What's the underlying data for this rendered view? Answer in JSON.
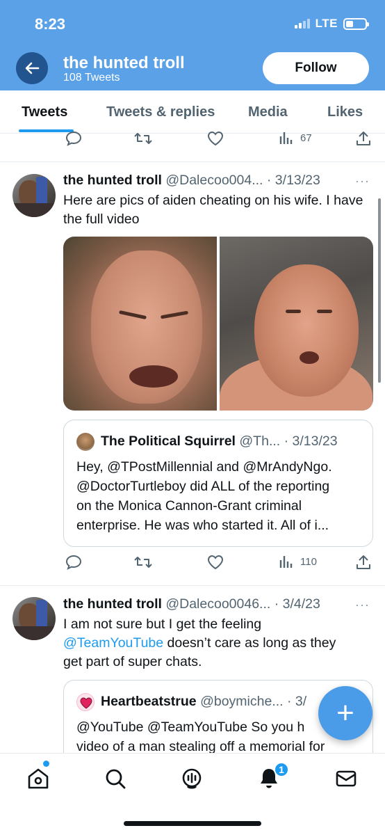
{
  "status_bar": {
    "time": "8:23",
    "network": "LTE"
  },
  "header": {
    "title": "the hunted troll",
    "subtitle": "108 Tweets",
    "follow_label": "Follow"
  },
  "tabs": [
    {
      "label": "Tweets",
      "active": true
    },
    {
      "label": "Tweets & replies",
      "active": false
    },
    {
      "label": "Media",
      "active": false
    },
    {
      "label": "Likes",
      "active": false
    }
  ],
  "top_actions": {
    "views": "67"
  },
  "tweets": [
    {
      "name": "the hunted troll",
      "handle": "@Dalecoo004...",
      "date": "· 3/13/23",
      "more": "···",
      "text": "Here are pics of aiden cheating on his wife. I have the full video",
      "quote": {
        "name": "The Political Squirrel",
        "handle": "@Th...",
        "date": "· 3/13/23",
        "text_line1": "Hey, @TPostMillennial and @MrAndyNgo.",
        "text_line2": "@DoctorTurtleboy did ALL of the reporting",
        "text_line3": "on the Monica Cannon-Grant criminal",
        "text_line4": "enterprise. He was who started it. All of i..."
      },
      "views": "110"
    },
    {
      "name": "the hunted troll",
      "handle": "@Dalecoo0046...",
      "date": "· 3/4/23",
      "more": "···",
      "text_line1": "I am not sure but I get the feeling",
      "text_mention": "@TeamYouTube",
      "text_line2_rest": " doesn’t care as long as they",
      "text_line3": "get part of super chats.",
      "quote": {
        "name": "Heartbeatstrue",
        "handle": "@boymiche...",
        "date": "· 3/",
        "text_line1": "@YouTube @TeamYouTube  So you h",
        "text_line2": "video of a man stealing off a memorial for"
      }
    }
  ],
  "bottom_nav": {
    "notifications_badge": "1"
  },
  "fab": {
    "label": "+"
  },
  "colors": {
    "header_bg": "#5aa1e8",
    "accent": "#1d9bf0",
    "back_button": "#22548f"
  },
  "icons": [
    "back-arrow-icon",
    "reply-icon",
    "retweet-icon",
    "like-icon",
    "views-icon",
    "share-icon",
    "home-icon",
    "search-icon",
    "spaces-icon",
    "notifications-icon",
    "messages-icon"
  ]
}
